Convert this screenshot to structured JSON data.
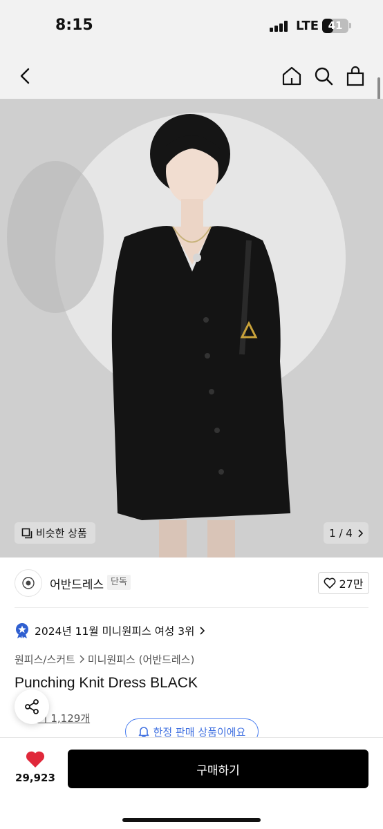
{
  "status": {
    "time": "8:15",
    "carrier": "LTE",
    "battery": "41",
    "battery_level": 0.41
  },
  "header": {
    "icons": [
      "back-icon",
      "home-icon",
      "search-icon",
      "shopping-bag-icon"
    ]
  },
  "hero": {
    "similar_label": "비슷한 상품",
    "page_indicator": "1 / 4",
    "colors": {
      "background": "#cfcfcf",
      "spotlight": "#e6e6e6",
      "garment": "#141414"
    }
  },
  "brand": {
    "name": "어반드레스",
    "badge": "단독",
    "likes": "27만"
  },
  "ranking": {
    "text": "2024년 11월 미니원피스 여성 3위"
  },
  "breadcrumb": {
    "category": "원피스/스커트",
    "subcategory": "미니원피스 (어반드레스)"
  },
  "product": {
    "title": "Punching Knit Dress BLACK"
  },
  "reviews": {
    "label": "후기 1,129개"
  },
  "notice": {
    "limited_label": "한정 판매 상품이에요",
    "accent": "#3e6fe0"
  },
  "bottom_bar": {
    "wish_count": "29,923",
    "buy_label": "구매하기",
    "heart_color": "#e0283a"
  }
}
